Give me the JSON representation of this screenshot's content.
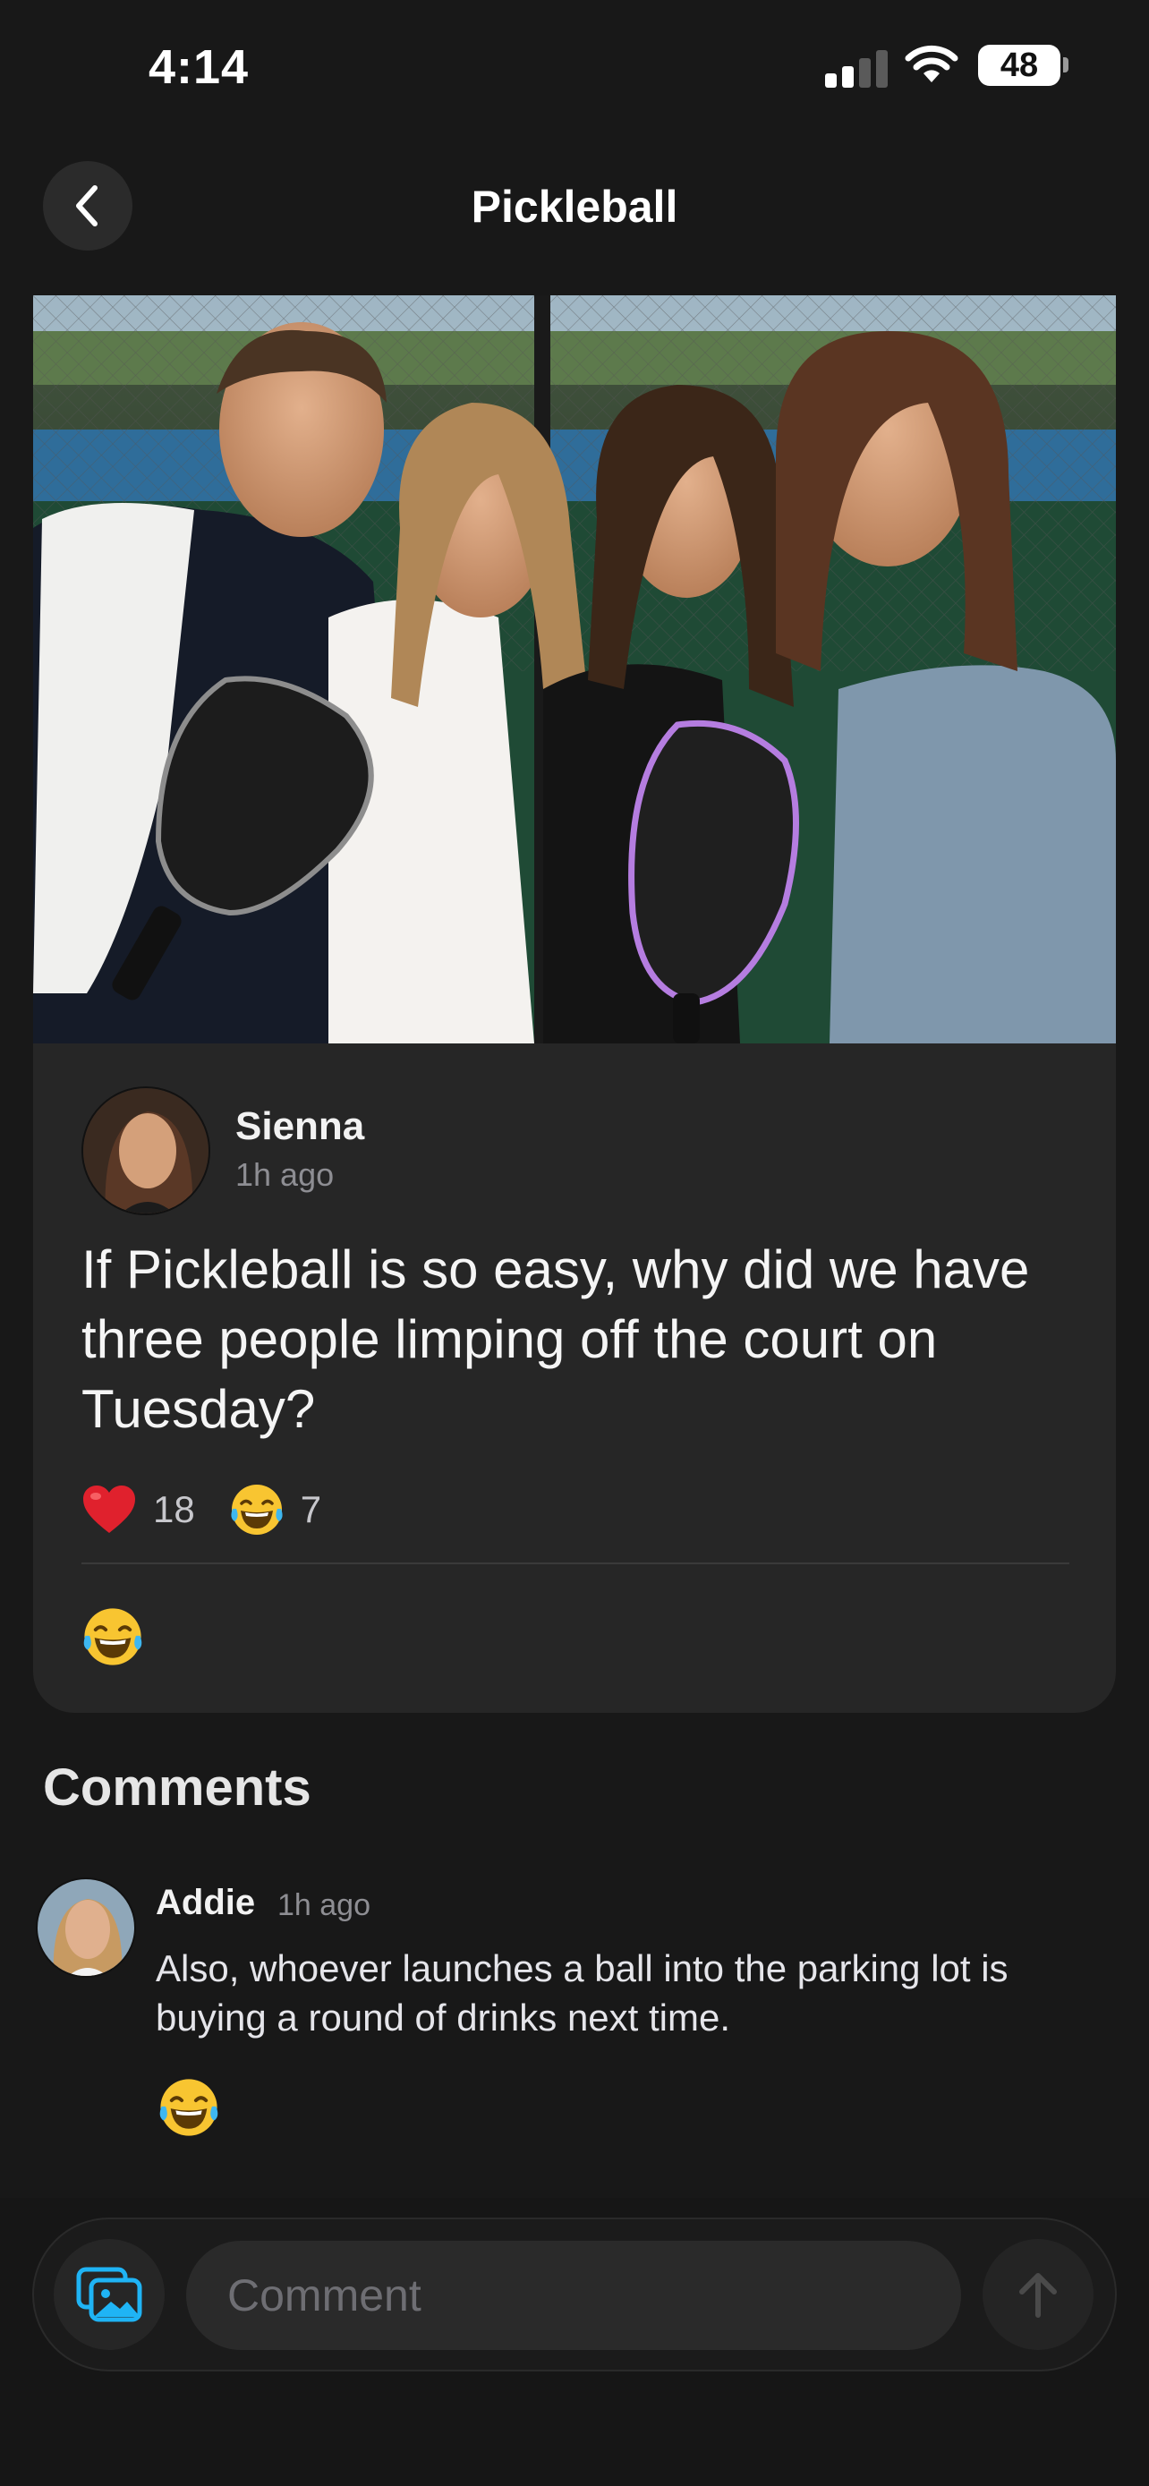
{
  "status_bar": {
    "time": "4:14",
    "battery": "48"
  },
  "nav": {
    "title": "Pickleball"
  },
  "post": {
    "author": "Sienna",
    "time": "1h ago",
    "text": "If Pickleball is so easy, why did we have three people limping off the court on Tuesday?",
    "reactions": [
      {
        "icon": "heart",
        "count": "18"
      },
      {
        "icon": "laughing-face",
        "count": "7"
      }
    ]
  },
  "comments": {
    "title": "Comments",
    "items": [
      {
        "author": "Addie",
        "time": "1h ago",
        "text": "Also, whoever launches a ball into the parking lot is buying a round of drinks next time.",
        "reaction_icon": "laughing-face"
      }
    ]
  },
  "composer": {
    "placeholder": "Comment"
  },
  "colors": {
    "background": "#181818",
    "card": "#262626",
    "accent": "#1fb4f5"
  }
}
